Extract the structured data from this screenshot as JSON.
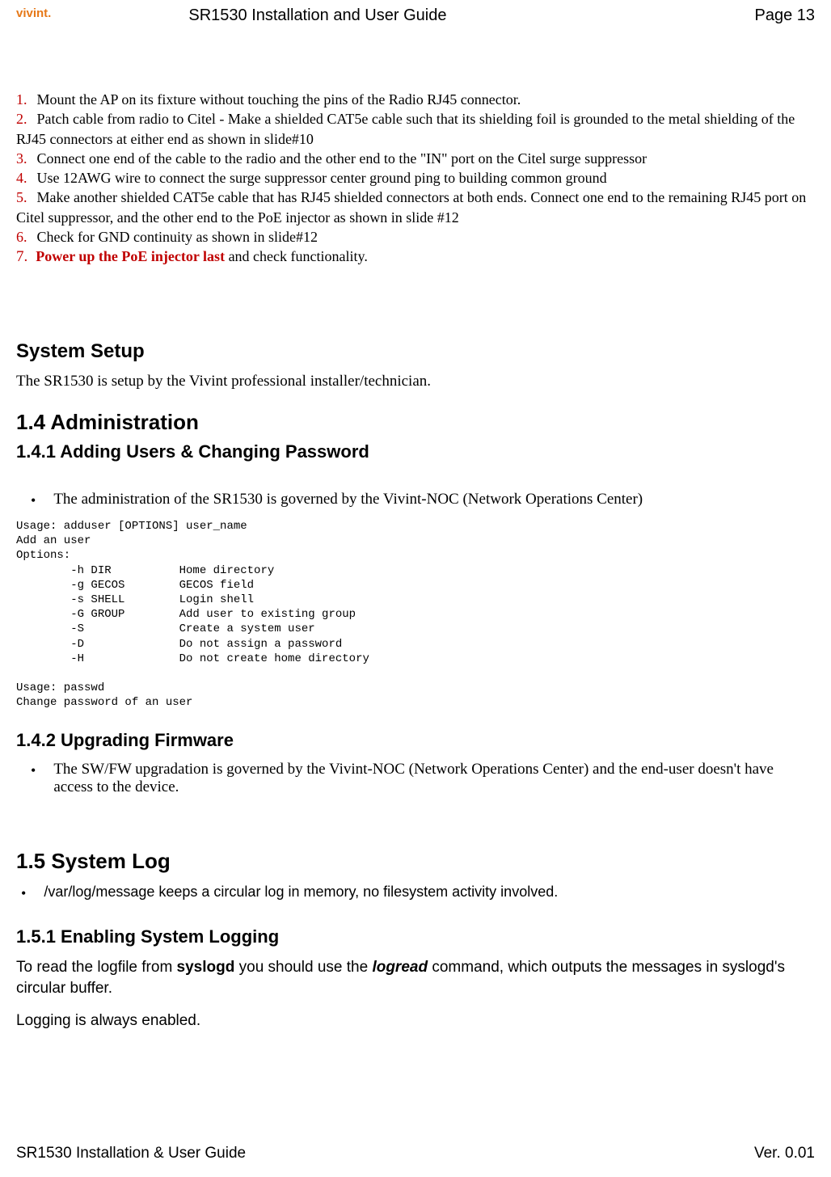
{
  "header": {
    "logo": "vivint.",
    "title": "SR1530 Installation and User Guide",
    "page": "Page 13"
  },
  "steps": {
    "n1": "1.",
    "t1": "Mount the AP on its fixture without touching the pins of the Radio RJ45 connector.",
    "n2": "2.",
    "t2": "Patch cable from radio to Citel - Make a shielded CAT5e cable such that its shielding foil is grounded to the metal shielding of the RJ45 connectors at either end as shown in slide#10",
    "n3": "3.",
    "t3": "Connect one end of the cable to the radio and the other end to the \"IN\" port on the Citel surge suppressor",
    "n4": "4.",
    "t4": "Use 12AWG wire to connect the surge suppressor center ground ping to building common ground",
    "n5": "5.",
    "t5": "Make another shielded CAT5e cable that has RJ45 shielded connectors at both ends. Connect one end to the remaining RJ45 port on Citel suppressor, and the other end to the PoE injector as shown in slide #12",
    "n6": "6.",
    "t6": "Check for GND continuity as shown in slide#12",
    "n7": "7.",
    "t7a": "Power up the PoE injector last",
    "t7b": " and check functionality."
  },
  "system_setup": {
    "heading": "System Setup",
    "text": "The SR1530 is setup by the Vivint professional installer/technician."
  },
  "s14": {
    "heading": "1.4   Administration",
    "sub": "1.4.1 Adding Users & Changing Password",
    "bullet": "The administration of the SR1530 is governed by the Vivint-NOC (Network Operations Center)",
    "code": "Usage: adduser [OPTIONS] user_name\nAdd an user\nOptions:\n        -h DIR          Home directory\n        -g GECOS        GECOS field\n        -s SHELL        Login shell\n        -G GROUP        Add user to existing group\n        -S              Create a system user\n        -D              Do not assign a password\n        -H              Do not create home directory\n\nUsage: passwd\nChange password of an user"
  },
  "s142": {
    "heading": "1.4.2 Upgrading Firmware",
    "bullet": "The SW/FW upgradation is governed by the Vivint-NOC (Network Operations Center) and the end-user doesn't have access to the device."
  },
  "s15": {
    "heading": "1.5   System Log",
    "bullet": "/var/log/message keeps a circular log in memory, no filesystem activity involved."
  },
  "s151": {
    "heading": "1.5.1 Enabling System Logging",
    "p1_a": "To read the logfile from ",
    "p1_b": "syslogd",
    "p1_c": " you should use the ",
    "p1_d": "logread",
    "p1_e": " command, which outputs the messages in syslogd's circular buffer.",
    "p2": "Logging is always enabled."
  },
  "footer": {
    "left": "SR1530 Installation & User Guide",
    "right": "Ver. 0.01"
  }
}
